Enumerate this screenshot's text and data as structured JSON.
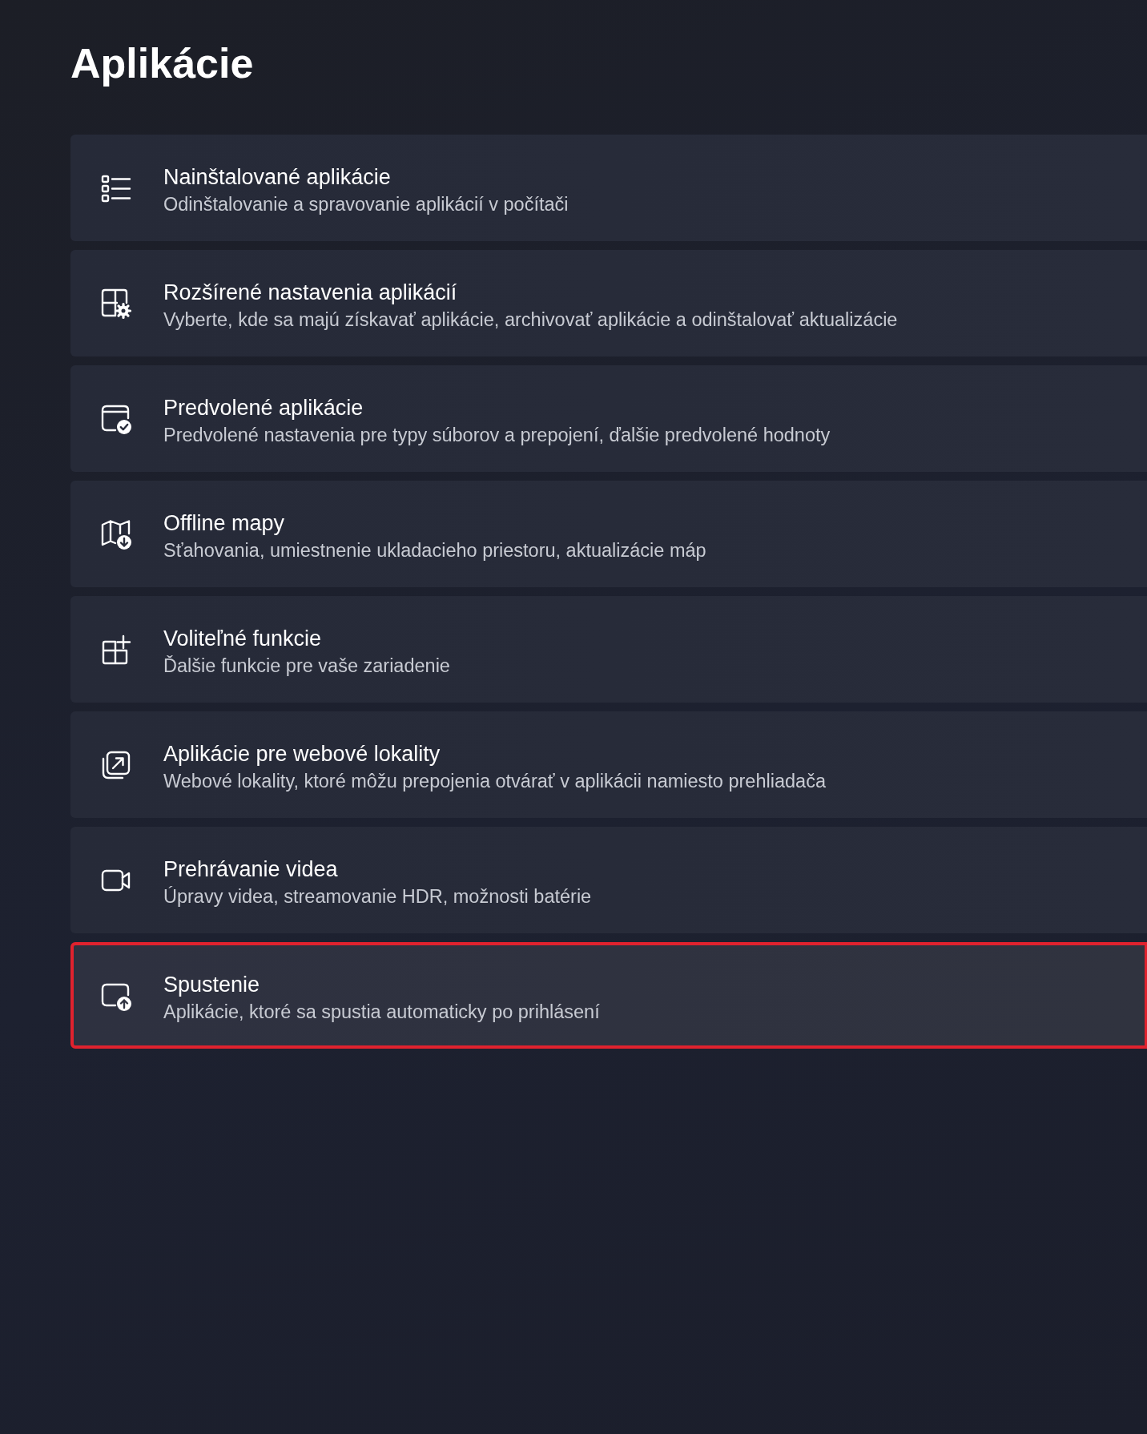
{
  "page": {
    "title": "Aplikácie"
  },
  "items": [
    {
      "title": "Nainštalované aplikácie",
      "subtitle": "Odinštalovanie a spravovanie aplikácií v počítači",
      "highlighted": false
    },
    {
      "title": "Rozšírené nastavenia aplikácií",
      "subtitle": "Vyberte, kde sa majú získavať aplikácie, archivovať aplikácie a odinštalovať aktualizácie",
      "highlighted": false
    },
    {
      "title": "Predvolené aplikácie",
      "subtitle": "Predvolené nastavenia pre typy súborov a prepojení, ďalšie predvolené hodnoty",
      "highlighted": false
    },
    {
      "title": "Offline mapy",
      "subtitle": "Sťahovania, umiestnenie ukladacieho priestoru, aktualizácie máp",
      "highlighted": false
    },
    {
      "title": "Voliteľné funkcie",
      "subtitle": "Ďalšie funkcie pre vaše zariadenie",
      "highlighted": false
    },
    {
      "title": "Aplikácie pre webové lokality",
      "subtitle": "Webové lokality, ktoré môžu prepojenia otvárať v aplikácii namiesto prehliadača",
      "highlighted": false
    },
    {
      "title": "Prehrávanie videa",
      "subtitle": "Úpravy videa, streamovanie HDR, možnosti batérie",
      "highlighted": false
    },
    {
      "title": "Spustenie",
      "subtitle": "Aplikácie, ktoré sa spustia automaticky po prihlásení",
      "highlighted": true
    }
  ]
}
